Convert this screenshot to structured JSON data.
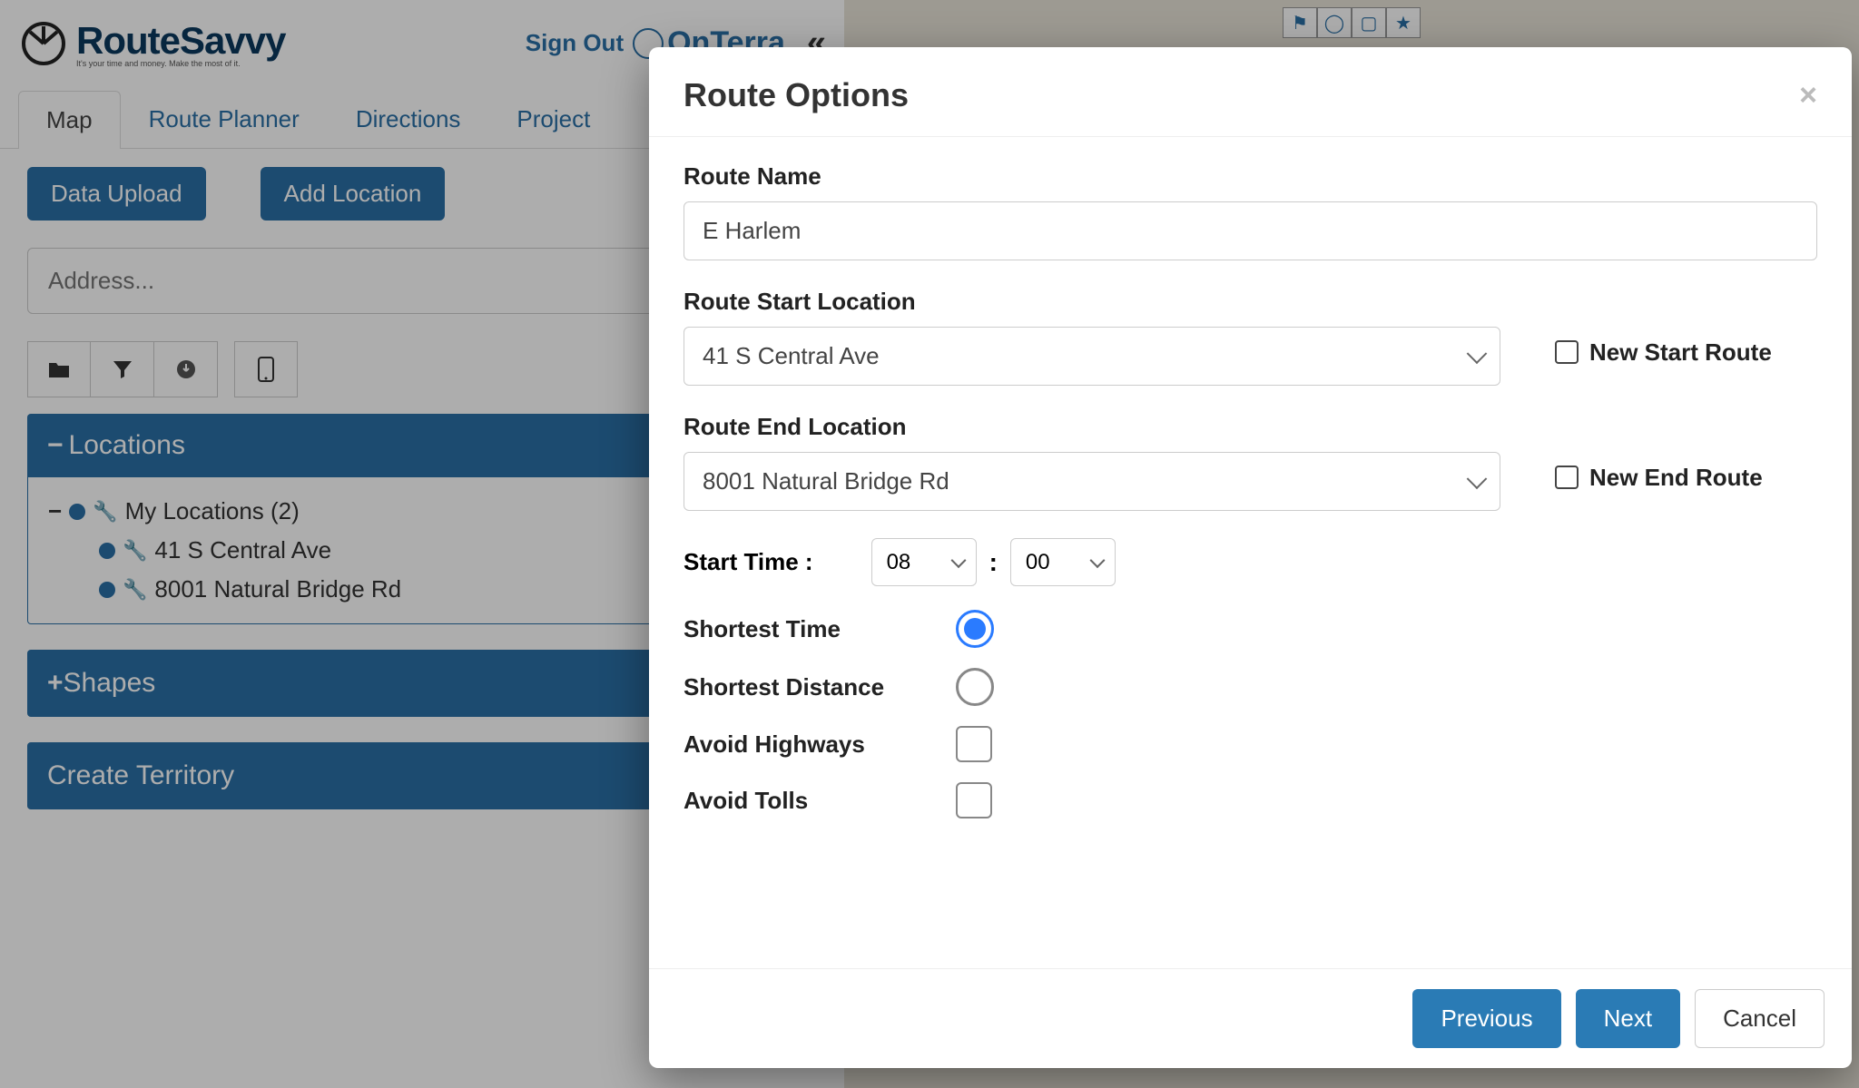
{
  "brand": {
    "name": "RouteSavvy",
    "tagline": "It's your time and money. Make the most of it.",
    "partner": "OnTerra"
  },
  "header": {
    "sign_out": "Sign Out",
    "collapse_icon": "«"
  },
  "tabs": [
    "Map",
    "Route Planner",
    "Directions",
    "Project"
  ],
  "active_tab": 0,
  "buttons": {
    "data_upload": "Data Upload",
    "add_location": "Add Location"
  },
  "search": {
    "placeholder": "Address..."
  },
  "toolbar_icons": [
    "folder-open-icon",
    "filter-icon",
    "download-icon",
    "mobile-icon"
  ],
  "sidebar": {
    "locations_header": "Locations",
    "root_label": "My Locations (2)",
    "items": [
      "41 S Central Ave",
      "8001 Natural Bridge Rd"
    ],
    "shapes_header": "Shapes",
    "territory_header": "Create Territory"
  },
  "map_controls": [
    "flag-icon",
    "circle-icon",
    "square-icon",
    "star-icon"
  ],
  "modal": {
    "title": "Route Options",
    "route_name_label": "Route Name",
    "route_name_value": "E Harlem",
    "start_label": "Route Start Location",
    "start_value": "41 S Central Ave",
    "new_start_label": "New Start Route",
    "end_label": "Route End Location",
    "end_value": "8001 Natural Bridge Rd",
    "new_end_label": "New End Route",
    "start_time_label": "Start Time :",
    "start_hour": "08",
    "start_min": "00",
    "opts": {
      "shortest_time": "Shortest Time",
      "shortest_distance": "Shortest Distance",
      "avoid_highways": "Avoid Highways",
      "avoid_tolls": "Avoid Tolls"
    },
    "selected_radio": "shortest_time",
    "footer": {
      "previous": "Previous",
      "next": "Next",
      "cancel": "Cancel"
    }
  }
}
